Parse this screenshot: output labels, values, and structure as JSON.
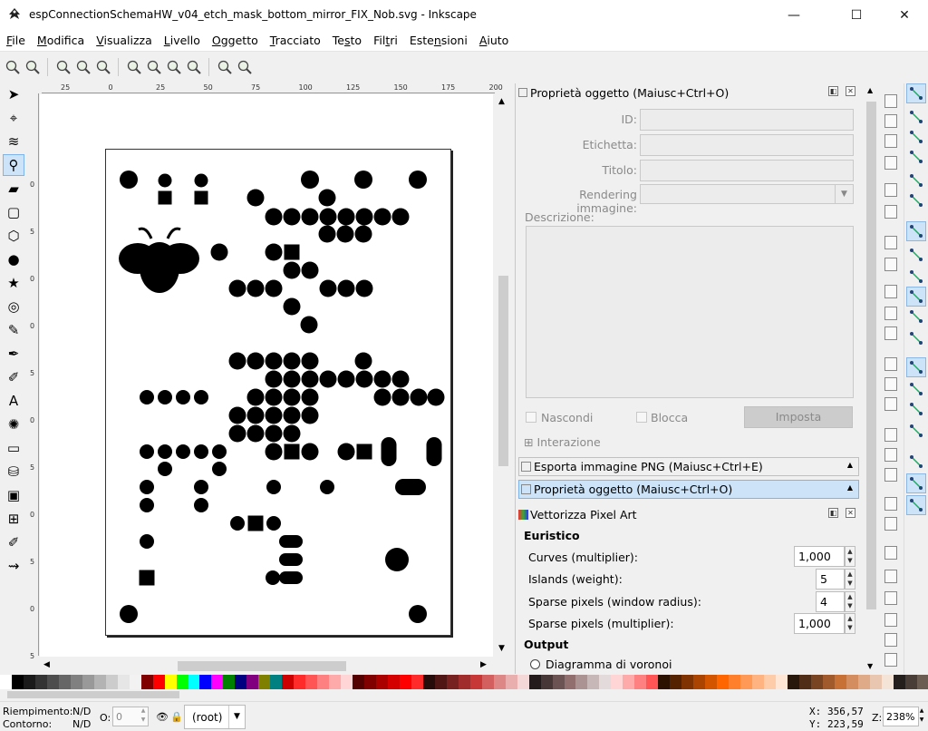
{
  "window": {
    "title": "espConnectionSchemaHW_v04_etch_mask_bottom_mirror_FIX_Nob.svg - Inkscape",
    "minimize": "—",
    "maximize": "☐",
    "close": "✕"
  },
  "menu": [
    {
      "pre": "",
      "u": "F",
      "post": "ile"
    },
    {
      "pre": "",
      "u": "M",
      "post": "odifica"
    },
    {
      "pre": "",
      "u": "V",
      "post": "isualizza"
    },
    {
      "pre": "",
      "u": "L",
      "post": "ivello"
    },
    {
      "pre": "",
      "u": "O",
      "post": "ggetto"
    },
    {
      "pre": "",
      "u": "T",
      "post": "racciato"
    },
    {
      "pre": "Te",
      "u": "s",
      "post": "to"
    },
    {
      "pre": "Fil",
      "u": "t",
      "post": "ri"
    },
    {
      "pre": "Este",
      "u": "n",
      "post": "sioni"
    },
    {
      "pre": "",
      "u": "A",
      "post": "iuto"
    }
  ],
  "ruler": {
    "h": [
      "25",
      "0",
      "25",
      "50",
      "75",
      "100",
      "125",
      "150",
      "175",
      "200"
    ],
    "v": [
      "0",
      "5",
      "0",
      "0",
      "5",
      "0",
      "5",
      "0",
      "5",
      "0",
      "5"
    ]
  },
  "panels": {
    "props": {
      "title": "Proprietà oggetto (Maiusc+Ctrl+O)",
      "id_label": "ID:",
      "label_label": "Etichetta:",
      "title_label": "Titolo:",
      "render_label": "Rendering immagine:",
      "desc_label": "Descrizione:",
      "hide_label": "Nascondi",
      "lock_label": "Blocca",
      "set_button": "Imposta",
      "interaction": "Interazione"
    },
    "export": {
      "title": "Esporta immagine PNG (Maiusc+Ctrl+E)"
    },
    "props_tab": {
      "title": "Proprietà oggetto (Maiusc+Ctrl+O)"
    },
    "vectorize": {
      "title": "Vettorizza Pixel Art",
      "heuristic": "Euristico",
      "curves_label": "Curves (multiplier):",
      "curves_value": "1,000",
      "islands_label": "Islands (weight):",
      "islands_value": "5",
      "sparse_radius_label": "Sparse pixels (window radius):",
      "sparse_radius_value": "4",
      "sparse_mult_label": "Sparse pixels (multiplier):",
      "sparse_mult_value": "1,000",
      "output": "Output",
      "voronoi": "Diagramma di voronoi"
    }
  },
  "status": {
    "fill_label": "Riempimento:",
    "fill_value": "N/D",
    "stroke_label": "Contorno:",
    "stroke_value": "N/D",
    "opacity_label": "O:",
    "opacity_value": "0",
    "layer": "(root)",
    "x_label": "X:",
    "x_value": "356,57",
    "y_label": "Y:",
    "y_value": "223,59",
    "z_label": "Z:",
    "zoom": "238%"
  },
  "colors": {
    "accent": "#cde3f7",
    "accent_border": "#7eb4ea"
  }
}
